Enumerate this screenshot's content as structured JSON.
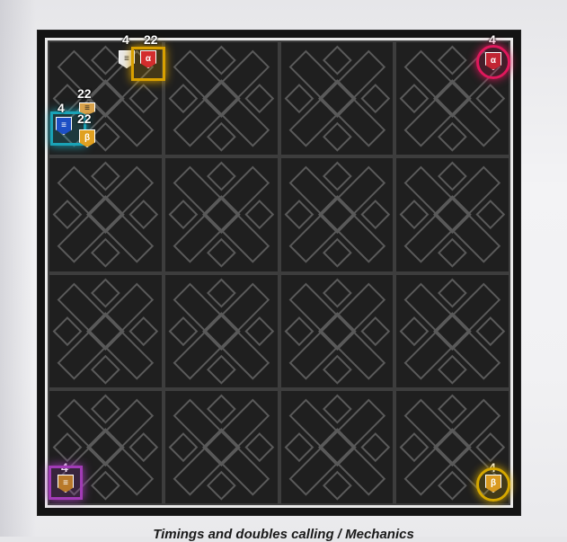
{
  "board": {
    "rows": 4,
    "cols": 4
  },
  "markers": {
    "top_left_a": {
      "count": "4",
      "glyph": "≡"
    },
    "top_left_b": {
      "count": "22",
      "glyph": "α",
      "color": "#d32d2d",
      "glow": "#d8a000"
    },
    "left_a": {
      "count": "4",
      "glyph": "≡",
      "color": "#1d4fc4",
      "glow": "#1aa3b7"
    },
    "left_b": {
      "count": "22",
      "glyph": "≡"
    },
    "left_c": {
      "count": "22",
      "glyph": "β",
      "color": "#e0a020"
    },
    "top_right": {
      "count": "4",
      "glyph": "α",
      "color": "#c22533",
      "glow": "#e0185c"
    },
    "bottom_left": {
      "count": "4",
      "glyph": "≡",
      "color": "#b8792a",
      "glow": "#a23bb7"
    },
    "bottom_right": {
      "count": "4",
      "glyph": "β",
      "color": "#d99a20",
      "glow": "#d6a800"
    }
  },
  "caption": "Timings and doubles calling / Mechanics"
}
